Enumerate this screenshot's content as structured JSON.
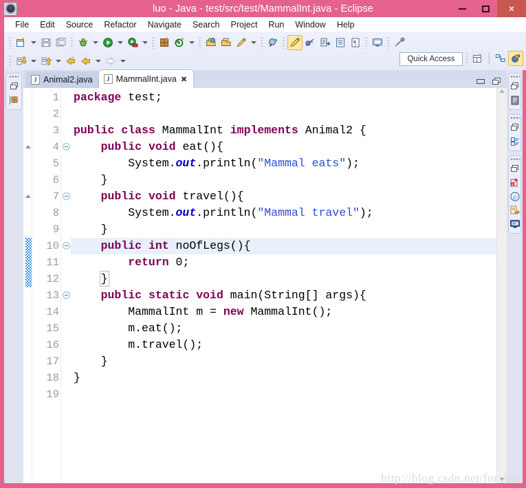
{
  "window": {
    "title": "luo - Java - test/src/test/MammalInt.java - Eclipse",
    "minimize_label": "–",
    "maximize_label": "□",
    "close_label": "✕",
    "app_icon": "eclipse-icon"
  },
  "menubar": {
    "items": [
      {
        "label": "File"
      },
      {
        "label": "Edit"
      },
      {
        "label": "Source"
      },
      {
        "label": "Refactor"
      },
      {
        "label": "Navigate"
      },
      {
        "label": "Search"
      },
      {
        "label": "Project"
      },
      {
        "label": "Run"
      },
      {
        "label": "Window"
      },
      {
        "label": "Help"
      }
    ]
  },
  "toolbar": {
    "quick_access_label": "Quick Access",
    "row1": [
      {
        "name": "new-wizard-icon",
        "has_dropdown": true
      },
      {
        "name": "save-icon",
        "has_dropdown": false
      },
      {
        "name": "save-all-icon",
        "has_dropdown": false
      },
      {
        "name": "debug-icon",
        "has_dropdown": true
      },
      {
        "name": "run-icon",
        "has_dropdown": true
      },
      {
        "name": "run-external-tools-icon",
        "has_dropdown": true
      },
      {
        "name": "new-java-package-icon",
        "has_dropdown": false
      },
      {
        "name": "new-java-class-icon",
        "has_dropdown": true
      },
      {
        "name": "open-type-icon",
        "has_dropdown": false
      },
      {
        "name": "open-task-icon",
        "has_dropdown": false
      },
      {
        "name": "annotation-icon",
        "has_dropdown": true
      },
      {
        "name": "search-icon",
        "has_dropdown": false
      },
      {
        "name": "mark-occurrences-icon",
        "has_dropdown": false,
        "selected": true
      },
      {
        "name": "skip-breakpoints-icon",
        "has_dropdown": false
      },
      {
        "name": "next-annotation-icon",
        "has_dropdown": false
      },
      {
        "name": "previous-annotation-icon",
        "has_dropdown": false
      },
      {
        "name": "last-edit-location-icon",
        "has_dropdown": false
      },
      {
        "name": "terminal-icon",
        "has_dropdown": false
      },
      {
        "name": "pin-editor-icon",
        "has_dropdown": false
      }
    ],
    "row2": [
      {
        "name": "next-edit-icon",
        "has_dropdown": true
      },
      {
        "name": "previous-edit-icon",
        "has_dropdown": true
      },
      {
        "name": "back-history-icon",
        "has_dropdown": false
      },
      {
        "name": "back-arrow-icon",
        "has_dropdown": true
      },
      {
        "name": "forward-arrow-icon",
        "has_dropdown": true
      }
    ],
    "perspective": [
      {
        "name": "open-perspective-icon"
      },
      {
        "name": "perspective-java-browsing-icon"
      },
      {
        "name": "perspective-java-icon",
        "selected": true
      }
    ]
  },
  "left_fastview": {
    "groups": [
      {
        "icons": [
          "restore-view-icon",
          "package-explorer-icon"
        ]
      }
    ]
  },
  "right_fastview": {
    "groups": [
      {
        "icons": [
          "restore-view-icon",
          "outline-view-icon"
        ]
      },
      {
        "icons": [
          "restore-view-icon",
          "task-list-icon"
        ]
      },
      {
        "icons": [
          "restore-view-icon",
          "problems-view-icon",
          "javadoc-view-icon",
          "declaration-view-icon",
          "console-view-icon"
        ]
      }
    ]
  },
  "editor": {
    "tabs": [
      {
        "label": "Animal2.java",
        "active": false,
        "closable": false,
        "icon": "java-file-icon"
      },
      {
        "label": "MammalInt.java",
        "active": true,
        "closable": true,
        "close_label": "✖",
        "icon": "java-file-icon"
      }
    ],
    "tab_controls": [
      {
        "name": "minimize-editor-icon"
      },
      {
        "name": "maximize-editor-icon"
      }
    ],
    "current_line": 10,
    "change_bar_lines": [
      10,
      11,
      12
    ],
    "override_marker_lines": [
      4,
      7
    ],
    "fold_marker_lines": [
      4,
      7,
      10,
      13
    ],
    "lines": [
      {
        "n": 1,
        "tokens": [
          {
            "t": "package",
            "c": "kw"
          },
          {
            "t": " test;",
            "c": "plain"
          }
        ]
      },
      {
        "n": 2,
        "tokens": [
          {
            "t": "",
            "c": "plain"
          }
        ]
      },
      {
        "n": 3,
        "tokens": [
          {
            "t": "public",
            "c": "kw"
          },
          {
            "t": " ",
            "c": "plain"
          },
          {
            "t": "class",
            "c": "kw"
          },
          {
            "t": " MammalInt ",
            "c": "plain"
          },
          {
            "t": "implements",
            "c": "kw"
          },
          {
            "t": " Animal2 {",
            "c": "plain"
          }
        ]
      },
      {
        "n": 4,
        "tokens": [
          {
            "t": "    ",
            "c": "plain"
          },
          {
            "t": "public",
            "c": "kw"
          },
          {
            "t": " ",
            "c": "plain"
          },
          {
            "t": "void",
            "c": "kw"
          },
          {
            "t": " eat(){",
            "c": "plain"
          }
        ]
      },
      {
        "n": 5,
        "tokens": [
          {
            "t": "        System.",
            "c": "plain"
          },
          {
            "t": "out",
            "c": "fld"
          },
          {
            "t": ".println(",
            "c": "plain"
          },
          {
            "t": "\"Mammal eats\"",
            "c": "str"
          },
          {
            "t": ");",
            "c": "plain"
          }
        ]
      },
      {
        "n": 6,
        "tokens": [
          {
            "t": "    }",
            "c": "plain"
          }
        ]
      },
      {
        "n": 7,
        "tokens": [
          {
            "t": "    ",
            "c": "plain"
          },
          {
            "t": "public",
            "c": "kw"
          },
          {
            "t": " ",
            "c": "plain"
          },
          {
            "t": "void",
            "c": "kw"
          },
          {
            "t": " travel(){",
            "c": "plain"
          }
        ]
      },
      {
        "n": 8,
        "tokens": [
          {
            "t": "        System.",
            "c": "plain"
          },
          {
            "t": "out",
            "c": "fld"
          },
          {
            "t": ".println(",
            "c": "plain"
          },
          {
            "t": "\"Mammal travel\"",
            "c": "str"
          },
          {
            "t": ");",
            "c": "plain"
          }
        ]
      },
      {
        "n": 9,
        "tokens": [
          {
            "t": "    }",
            "c": "plain"
          }
        ]
      },
      {
        "n": 10,
        "tokens": [
          {
            "t": "    ",
            "c": "plain"
          },
          {
            "t": "public",
            "c": "kw"
          },
          {
            "t": " ",
            "c": "plain"
          },
          {
            "t": "int",
            "c": "kw"
          },
          {
            "t": " noOfLegs(){",
            "c": "plain"
          }
        ]
      },
      {
        "n": 11,
        "tokens": [
          {
            "t": "        ",
            "c": "plain"
          },
          {
            "t": "return",
            "c": "kw"
          },
          {
            "t": " 0;",
            "c": "plain"
          }
        ]
      },
      {
        "n": 12,
        "tokens": [
          {
            "t": "    ",
            "c": "plain"
          },
          {
            "t": "}",
            "c": "plain brk-box"
          }
        ]
      },
      {
        "n": 13,
        "tokens": [
          {
            "t": "    ",
            "c": "plain"
          },
          {
            "t": "public",
            "c": "kw"
          },
          {
            "t": " ",
            "c": "plain"
          },
          {
            "t": "static",
            "c": "kw"
          },
          {
            "t": " ",
            "c": "plain"
          },
          {
            "t": "void",
            "c": "kw"
          },
          {
            "t": " main(String[] args){",
            "c": "plain"
          }
        ]
      },
      {
        "n": 14,
        "tokens": [
          {
            "t": "        MammalInt m = ",
            "c": "plain"
          },
          {
            "t": "new",
            "c": "kw"
          },
          {
            "t": " MammalInt();",
            "c": "plain"
          }
        ]
      },
      {
        "n": 15,
        "tokens": [
          {
            "t": "        m.eat();",
            "c": "plain"
          }
        ]
      },
      {
        "n": 16,
        "tokens": [
          {
            "t": "        m.travel();",
            "c": "plain"
          }
        ]
      },
      {
        "n": 17,
        "tokens": [
          {
            "t": "    }",
            "c": "plain"
          }
        ]
      },
      {
        "n": 18,
        "tokens": [
          {
            "t": "}",
            "c": "plain"
          }
        ]
      },
      {
        "n": 19,
        "tokens": [
          {
            "t": "",
            "c": "plain"
          }
        ]
      }
    ]
  },
  "watermark": {
    "text": "http://blog.csdn.net/for_luo"
  },
  "colors": {
    "title_bar": "#e4628c",
    "close_button": "#c9564f",
    "toolbar_bg": "#eef1fa",
    "tab_active": "#ffffff",
    "tab_inactive": "#c6d2e8",
    "tabbar_bg": "#d4dcee",
    "keyword": "#7f0055",
    "string": "#2a4fd6",
    "field": "#0000c0",
    "current_line": "#e8f0fb",
    "change_bar": "#3b8ee6",
    "gutter_text": "#9b9b9b"
  }
}
